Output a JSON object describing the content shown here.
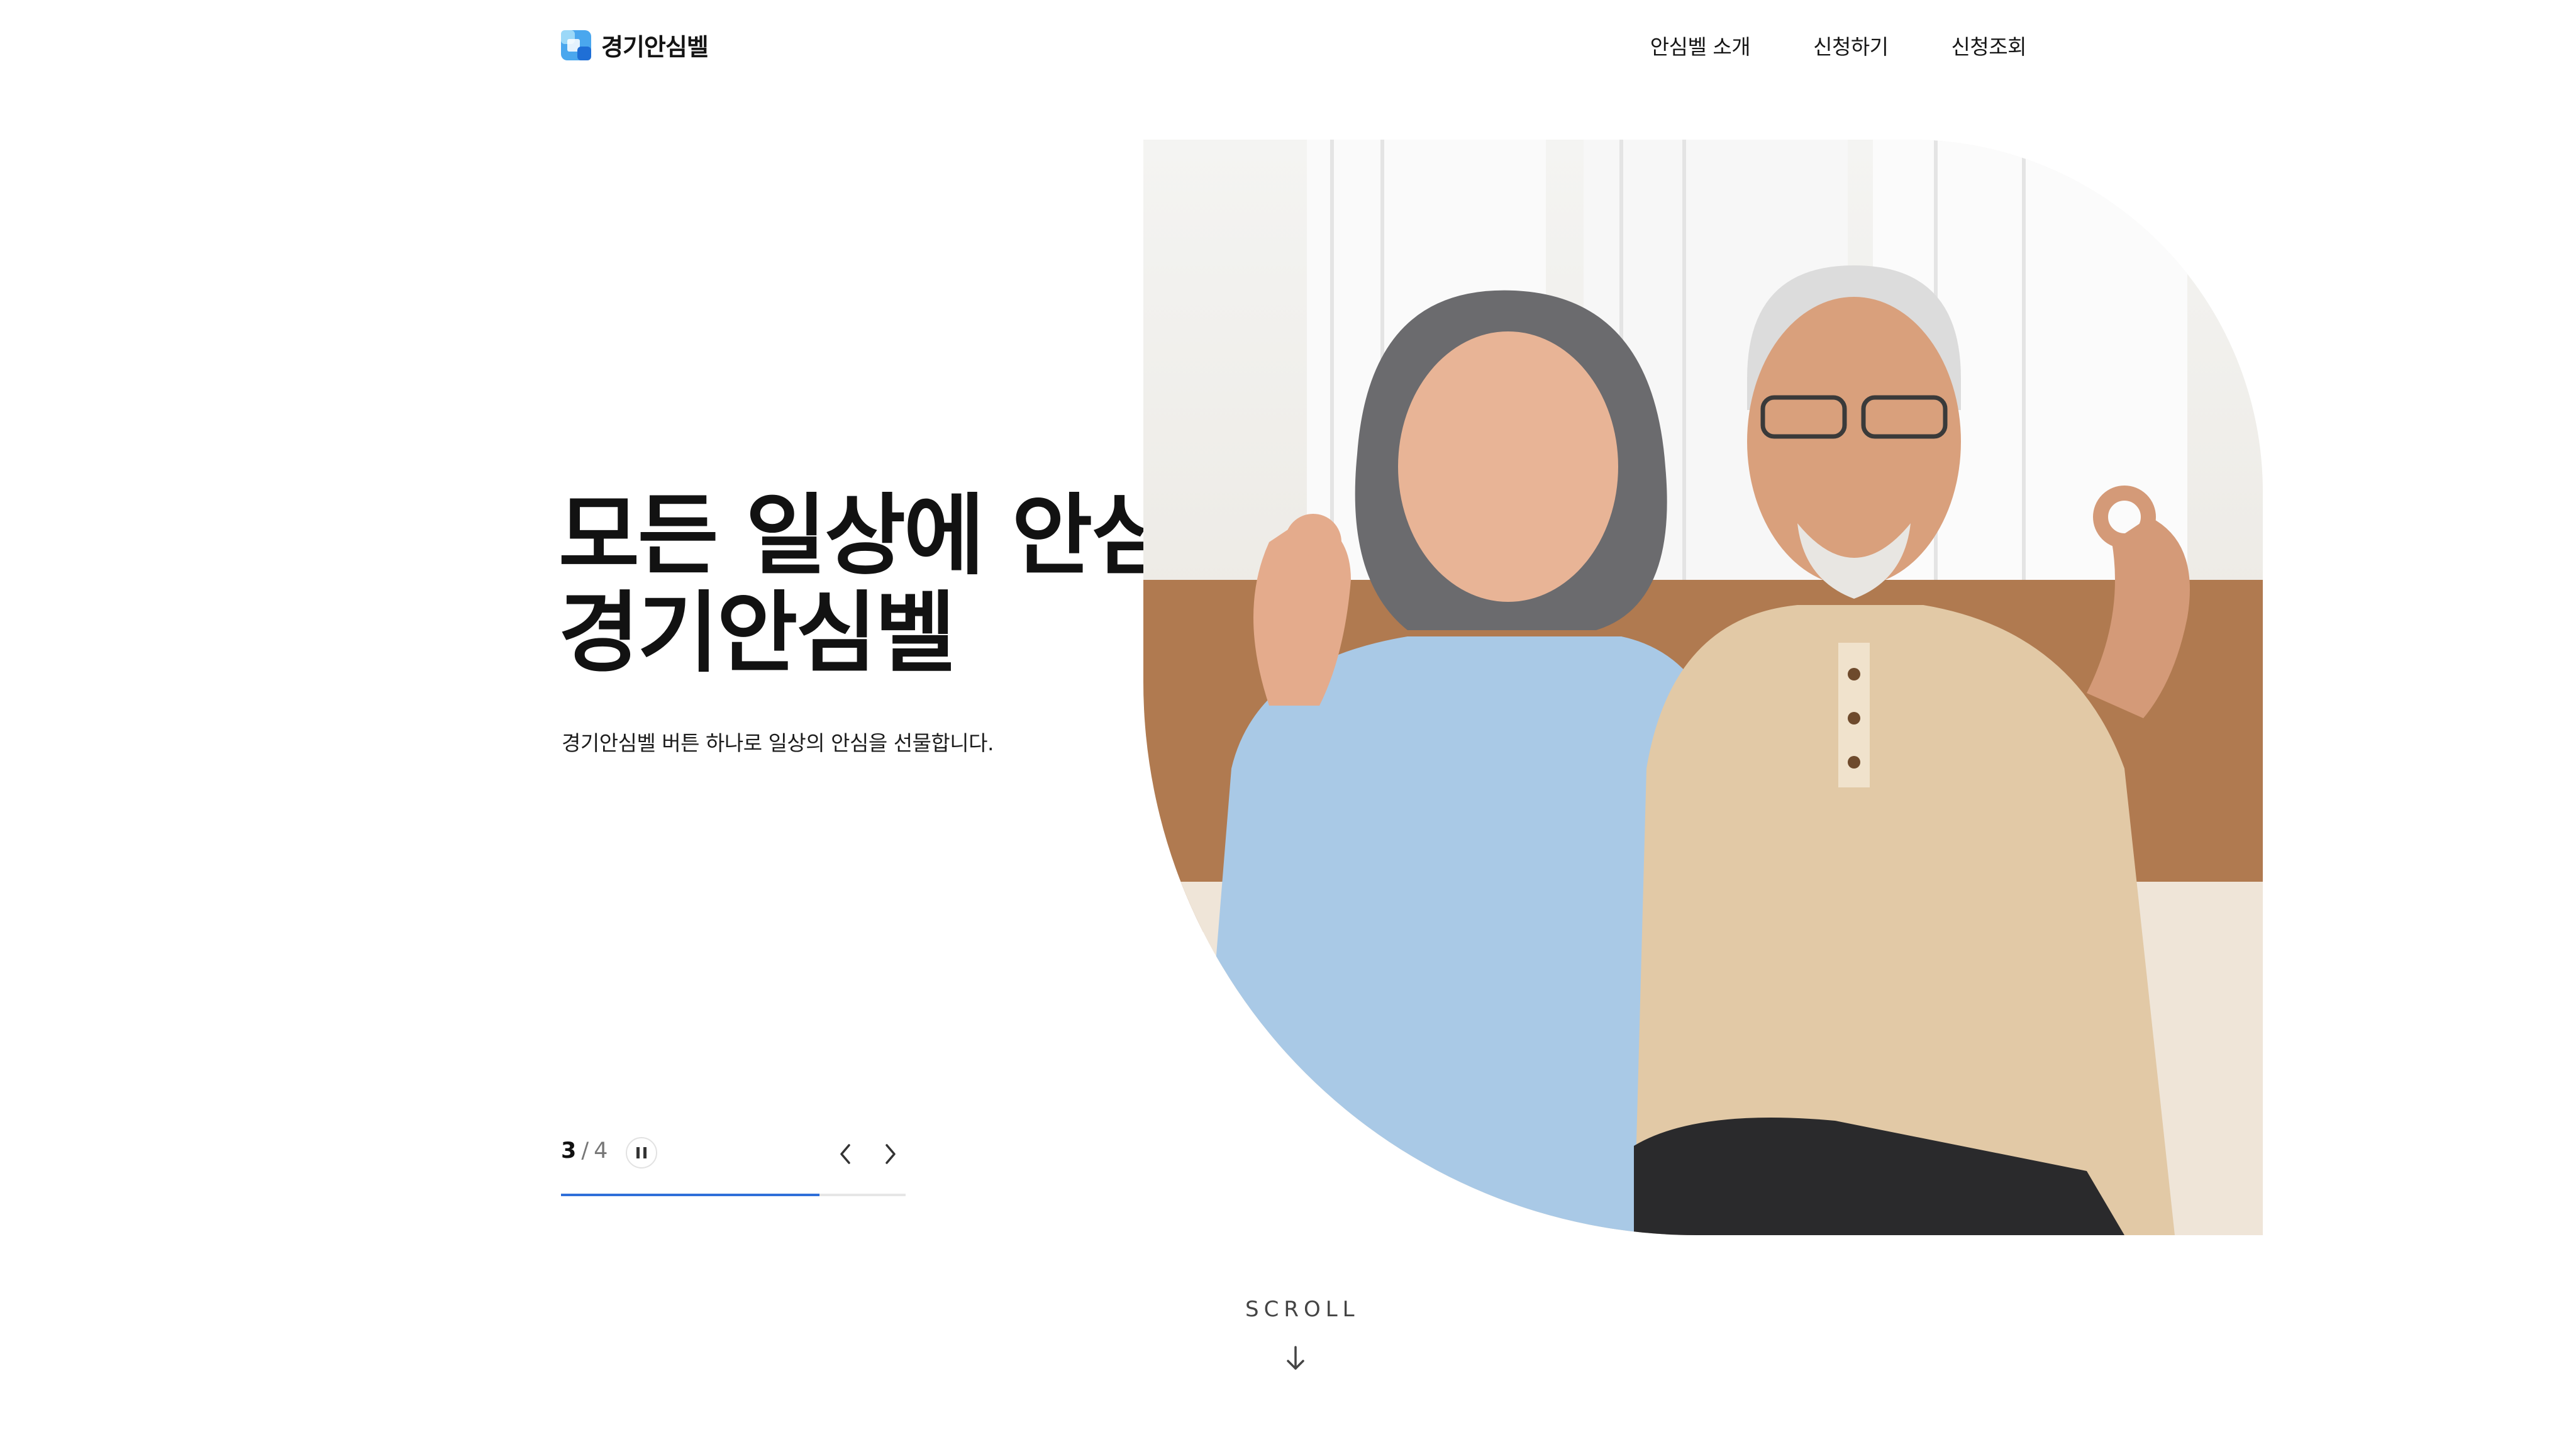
{
  "header": {
    "logo_text": "경기안심벨",
    "logo_icon": "gyeonggi-bell-logo-icon",
    "nav": [
      {
        "label": "안심벨 소개"
      },
      {
        "label": "신청하기"
      },
      {
        "label": "신청조회"
      }
    ]
  },
  "hero": {
    "title_line1": "모든 일상에 안심을,",
    "title_line2": "경기안심벨",
    "subtitle": "경기안심벨 버튼 하나로 일상의 안심을 선물합니다."
  },
  "slider": {
    "current": "3",
    "separator": "/",
    "total": "4",
    "progress": 0.75,
    "pause_icon": "pause-icon",
    "prev_icon": "chevron-left-icon",
    "next_icon": "chevron-right-icon"
  },
  "scroll": {
    "label": "SCROLL",
    "icon": "arrow-down-icon"
  },
  "colors": {
    "accent": "#2f6fd9",
    "logo_light": "#6fc3f5",
    "logo_dark": "#2b7fe0",
    "text": "#121212"
  }
}
